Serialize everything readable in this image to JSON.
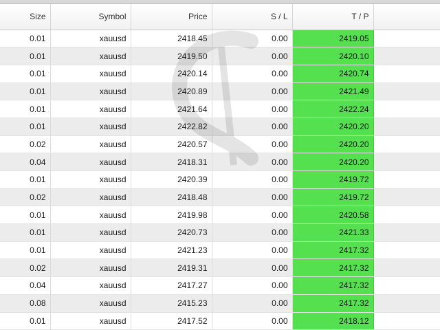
{
  "table": {
    "columns": {
      "size": "Size",
      "symbol": "Symbol",
      "price": "Price",
      "sl": "S / L",
      "tp": "T / P"
    },
    "rows": [
      {
        "size": "0.01",
        "symbol": "xauusd",
        "price": "2418.45",
        "sl": "0.00",
        "tp": "2419.05"
      },
      {
        "size": "0.01",
        "symbol": "xauusd",
        "price": "2419.50",
        "sl": "0.00",
        "tp": "2420.10"
      },
      {
        "size": "0.01",
        "symbol": "xauusd",
        "price": "2420.14",
        "sl": "0.00",
        "tp": "2420.74"
      },
      {
        "size": "0.01",
        "symbol": "xauusd",
        "price": "2420.89",
        "sl": "0.00",
        "tp": "2421.49"
      },
      {
        "size": "0.01",
        "symbol": "xauusd",
        "price": "2421.64",
        "sl": "0.00",
        "tp": "2422.24"
      },
      {
        "size": "0.01",
        "symbol": "xauusd",
        "price": "2422.82",
        "sl": "0.00",
        "tp": "2420.20"
      },
      {
        "size": "0.02",
        "symbol": "xauusd",
        "price": "2420.57",
        "sl": "0.00",
        "tp": "2420.20"
      },
      {
        "size": "0.04",
        "symbol": "xauusd",
        "price": "2418.31",
        "sl": "0.00",
        "tp": "2420.20"
      },
      {
        "size": "0.01",
        "symbol": "xauusd",
        "price": "2420.39",
        "sl": "0.00",
        "tp": "2419.72"
      },
      {
        "size": "0.02",
        "symbol": "xauusd",
        "price": "2418.48",
        "sl": "0.00",
        "tp": "2419.72"
      },
      {
        "size": "0.01",
        "symbol": "xauusd",
        "price": "2419.98",
        "sl": "0.00",
        "tp": "2420.58"
      },
      {
        "size": "0.01",
        "symbol": "xauusd",
        "price": "2420.73",
        "sl": "0.00",
        "tp": "2421.33"
      },
      {
        "size": "0.01",
        "symbol": "xauusd",
        "price": "2421.23",
        "sl": "0.00",
        "tp": "2417.32"
      },
      {
        "size": "0.02",
        "symbol": "xauusd",
        "price": "2419.31",
        "sl": "0.00",
        "tp": "2417.32"
      },
      {
        "size": "0.04",
        "symbol": "xauusd",
        "price": "2417.27",
        "sl": "0.00",
        "tp": "2417.32"
      },
      {
        "size": "0.08",
        "symbol": "xauusd",
        "price": "2415.23",
        "sl": "0.00",
        "tp": "2417.32"
      },
      {
        "size": "0.01",
        "symbol": "xauusd",
        "price": "2417.52",
        "sl": "0.00",
        "tp": "2418.12"
      }
    ]
  },
  "colors": {
    "tp_highlight": "#55e04f",
    "row_stripe": "#ececec"
  }
}
